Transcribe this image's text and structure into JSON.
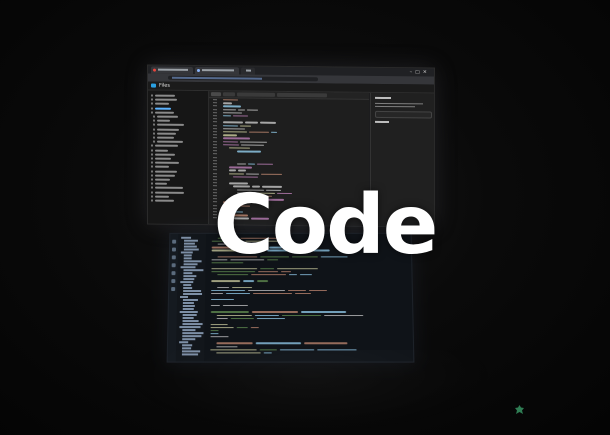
{
  "overlay_title": "Code",
  "top_monitor": {
    "app_title": "Files",
    "accent_color": "#2aa1e3"
  },
  "colors": {
    "background": "#070707",
    "code_keyword": "#c586c0",
    "code_string": "#ce9178",
    "code_ident": "#9cdcfe",
    "code_plain": "#d4d4d4",
    "code_comment": "#6a9955",
    "code_function": "#dcdcaa",
    "blob_color": "#2f7d54"
  }
}
